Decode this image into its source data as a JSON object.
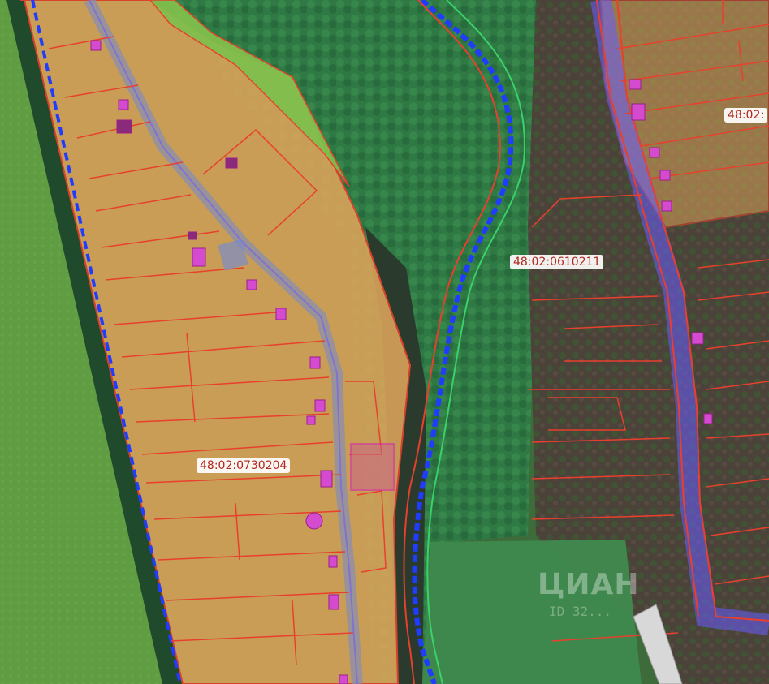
{
  "map": {
    "parcel_labels": [
      {
        "id": "0730204",
        "text": "48:02:0730204"
      },
      {
        "id": "0610211",
        "text": "48:02:0610211"
      },
      {
        "id": "partial",
        "text": "48:02:"
      }
    ],
    "watermark": {
      "brand": "ЦИАН",
      "sub": "ID 32..."
    },
    "colors": {
      "zone_orange": "#d9a35a",
      "zone_light_green": "#7fbf4d",
      "forest_green": "#2f7a44",
      "river_blue": "#1f3cff",
      "cadastral_red": "#e8402c",
      "building_magenta": "#d44bd0",
      "field_green": "#5c9a3e",
      "village_dark": "#4a4038",
      "highway_blue": "#6a5cff"
    }
  }
}
